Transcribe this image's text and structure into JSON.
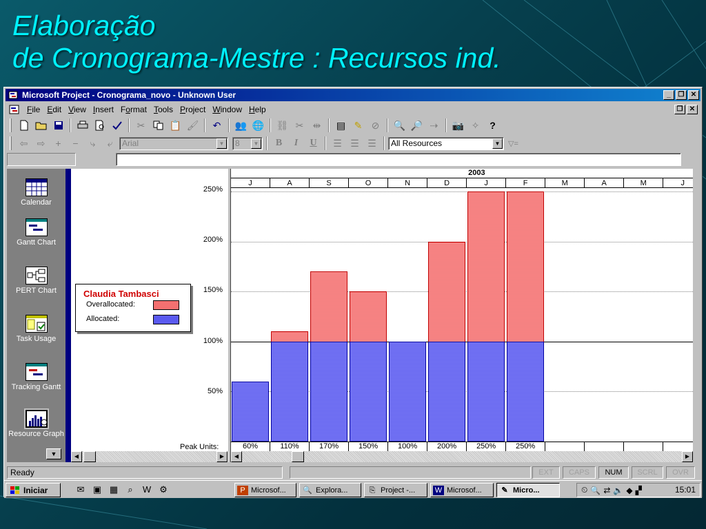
{
  "slide": {
    "title_line1": "Elaboração",
    "title_line2": "de Cronograma-Mestre : Recursos ind."
  },
  "window": {
    "title": "Microsoft Project - Cronograma_novo - Unknown User",
    "buttons": [
      "_",
      "❐",
      "✕"
    ]
  },
  "menu": {
    "items": [
      {
        "pre": "",
        "key": "F",
        "post": "ile"
      },
      {
        "pre": "",
        "key": "E",
        "post": "dit"
      },
      {
        "pre": "",
        "key": "V",
        "post": "iew"
      },
      {
        "pre": "",
        "key": "I",
        "post": "nsert"
      },
      {
        "pre": "F",
        "key": "o",
        "post": "rmat"
      },
      {
        "pre": "",
        "key": "T",
        "post": "ools"
      },
      {
        "pre": "",
        "key": "P",
        "post": "roject"
      },
      {
        "pre": "",
        "key": "W",
        "post": "indow"
      },
      {
        "pre": "",
        "key": "H",
        "post": "elp"
      }
    ]
  },
  "formatting": {
    "font": "Arial",
    "size": "8",
    "bold": "B",
    "italic": "I",
    "underline": "U",
    "filter": "All Resources"
  },
  "views": [
    {
      "label": "Calendar"
    },
    {
      "label": "Gantt Chart"
    },
    {
      "label": "PERT Chart"
    },
    {
      "label": "Task Usage"
    },
    {
      "label": "Tracking Gantt"
    },
    {
      "label": "Resource Graph"
    }
  ],
  "legend": {
    "resource": "Claudia Tambasci",
    "overallocated_label": "Overallocated:",
    "allocated_label": "Allocated:",
    "overallocated_color": "#f47070",
    "allocated_color": "#5a5af0"
  },
  "peak_units_label": "Peak Units:",
  "chart_data": {
    "type": "bar",
    "year_label": "2003",
    "year_starts_at_month_index": 6,
    "categories": [
      "J",
      "A",
      "S",
      "O",
      "N",
      "D",
      "J",
      "F",
      "M",
      "A",
      "M",
      "J"
    ],
    "peak_units": [
      "60%",
      "110%",
      "170%",
      "150%",
      "100%",
      "200%",
      "250%",
      "250%",
      "",
      "",
      "",
      ""
    ],
    "series": [
      {
        "name": "Allocated",
        "values": [
          60,
          100,
          100,
          100,
          100,
          100,
          100,
          100,
          null,
          null,
          null,
          null
        ]
      },
      {
        "name": "Overallocated",
        "values": [
          0,
          10,
          70,
          50,
          0,
          100,
          150,
          150,
          null,
          null,
          null,
          null
        ]
      }
    ],
    "yticks": [
      "250%",
      "200%",
      "150%",
      "100%",
      "50%"
    ],
    "ylim": [
      0,
      250
    ],
    "ylabel": "",
    "xlabel": "",
    "max_units_line": 100
  },
  "status": {
    "text": "Ready",
    "indicators": [
      {
        "label": "EXT",
        "on": false
      },
      {
        "label": "CAPS",
        "on": false
      },
      {
        "label": "NUM",
        "on": true
      },
      {
        "label": "SCRL",
        "on": false
      },
      {
        "label": "OVR",
        "on": false
      }
    ]
  },
  "taskbar": {
    "start_label": "Iniciar",
    "tasks": [
      {
        "label": "Microsof...",
        "icon": "powerpoint-icon"
      },
      {
        "label": "Explora...",
        "icon": "explorer-icon"
      },
      {
        "label": "Project -...",
        "icon": "project-icon"
      },
      {
        "label": "Microsof...",
        "icon": "word-icon"
      },
      {
        "label": "Micro...",
        "icon": "msproject-icon"
      }
    ],
    "clock": "15:01"
  }
}
